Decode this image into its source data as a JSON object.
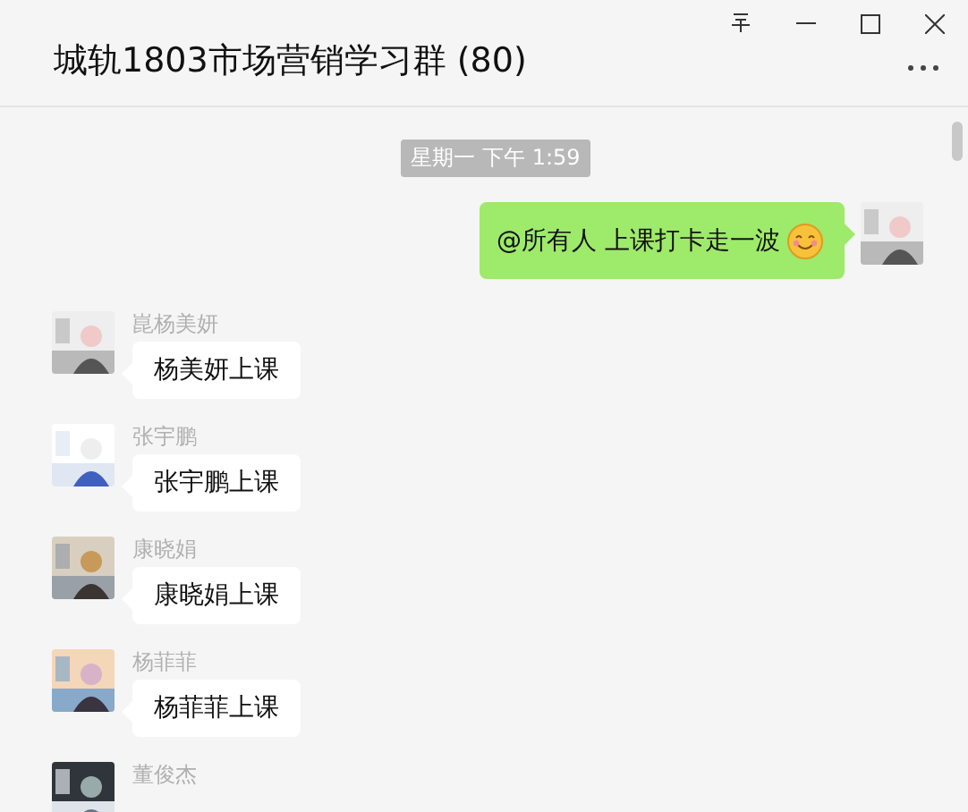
{
  "window": {
    "title": "城轨1803市场营销学习群 (80)"
  },
  "timestamp": "星期一 下午 1:59",
  "messages": [
    {
      "kind": "sent",
      "text": "@所有人 上课打卡走一波",
      "emoji": true
    },
    {
      "kind": "received",
      "sender": "崑杨美妍",
      "text": "杨美妍上课"
    },
    {
      "kind": "received",
      "sender": "张宇鹏",
      "text": "张宇鹏上课"
    },
    {
      "kind": "received",
      "sender": "康晓娟",
      "text": "康晓娟上课"
    },
    {
      "kind": "received",
      "sender": "杨菲菲",
      "text": "杨菲菲上课"
    },
    {
      "kind": "received",
      "sender": "董俊杰"
    }
  ]
}
